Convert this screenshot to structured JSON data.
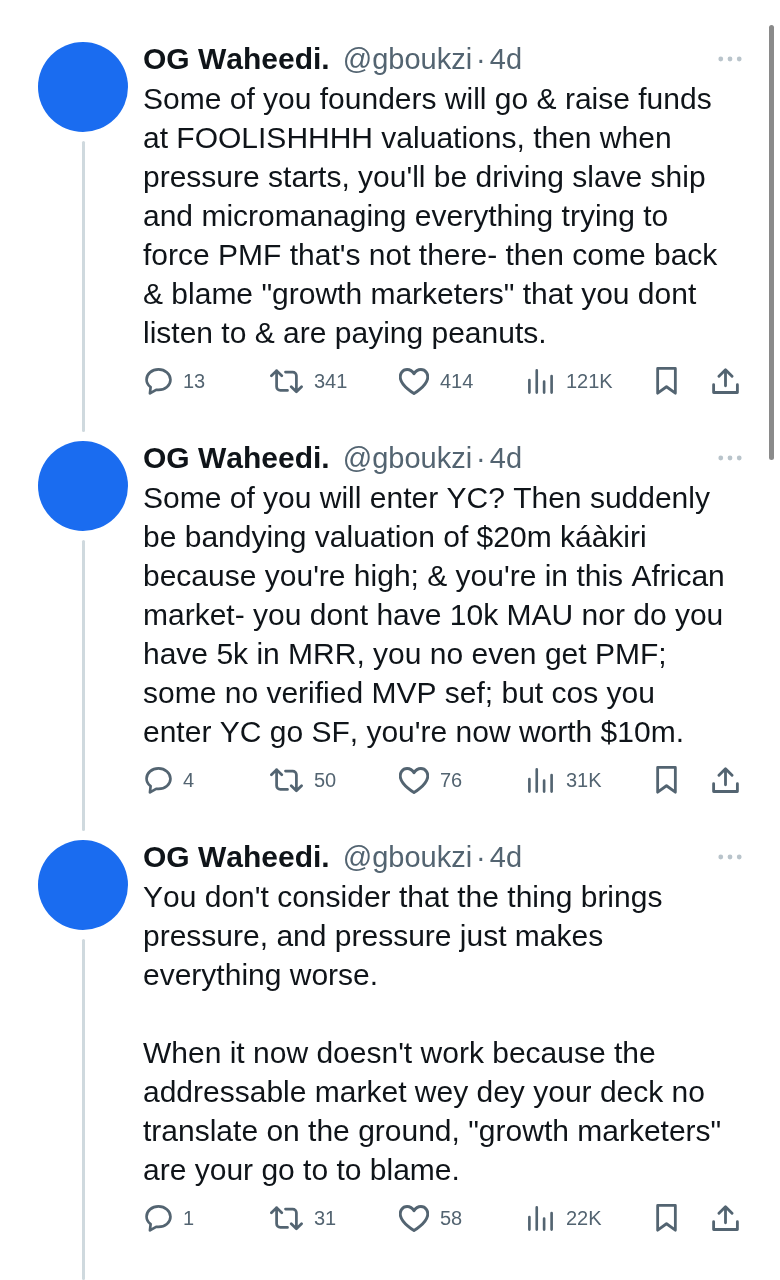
{
  "tweets": [
    {
      "name": "OG Waheedi.",
      "handle": "@gboukzi",
      "separator": "·",
      "time": "4d",
      "paragraphs": [
        "Some of you founders will go & raise funds at FOOLISHHHH valuations, then when pressure starts, you'll be driving slave ship and micromanaging everything trying to force PMF that's not there- then come back & blame \"growth marketers\" that you dont listen to & are paying peanuts."
      ],
      "actions": [
        {
          "kind": "reply",
          "count": "13"
        },
        {
          "kind": "repost",
          "count": "341"
        },
        {
          "kind": "like",
          "count": "414"
        },
        {
          "kind": "views",
          "count": "121K"
        },
        {
          "kind": "bookmark"
        },
        {
          "kind": "share"
        }
      ]
    },
    {
      "name": "OG Waheedi.",
      "handle": "@gboukzi",
      "separator": "·",
      "time": "4d",
      "paragraphs": [
        "Some of you will enter YC? Then suddenly be bandying valuation of $20m káàkiri because you're high; & you're in this African market- you dont have 10k MAU nor do you have 5k in MRR, you no even get PMF; some no verified MVP sef; but cos you enter YC go SF, you're now worth $10m."
      ],
      "actions": [
        {
          "kind": "reply",
          "count": "4"
        },
        {
          "kind": "repost",
          "count": "50"
        },
        {
          "kind": "like",
          "count": "76"
        },
        {
          "kind": "views",
          "count": "31K"
        },
        {
          "kind": "bookmark"
        },
        {
          "kind": "share"
        }
      ]
    },
    {
      "name": "OG Waheedi.",
      "handle": "@gboukzi",
      "separator": "·",
      "time": "4d",
      "paragraphs": [
        "You don't consider that the thing brings pressure, and pressure just makes everything worse.",
        "When it now doesn't work because the addressable market wey dey your deck no translate on the ground, \"growth marketers\" are your go to to blame."
      ],
      "actions": [
        {
          "kind": "reply",
          "count": "1"
        },
        {
          "kind": "repost",
          "count": "31"
        },
        {
          "kind": "like",
          "count": "58"
        },
        {
          "kind": "views",
          "count": "22K"
        },
        {
          "kind": "bookmark"
        },
        {
          "kind": "share"
        }
      ]
    }
  ]
}
